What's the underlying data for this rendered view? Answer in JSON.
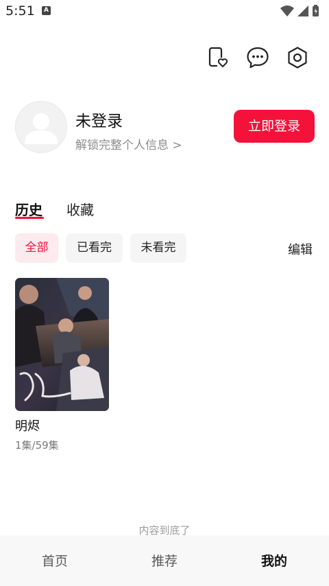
{
  "status_bar": {
    "time": "5:51",
    "notification_badge": "A"
  },
  "top_icons": [
    "favorite-phone-icon",
    "message-icon",
    "settings-icon"
  ],
  "profile": {
    "name": "未登录",
    "subtitle": "解锁完整个人信息 >",
    "login_button": "立即登录"
  },
  "tabs": {
    "history": "历史",
    "favorites": "收藏",
    "active": "history"
  },
  "filters": {
    "all": "全部",
    "watched": "已看完",
    "unwatched": "未看完",
    "edit": "编辑",
    "active": "all"
  },
  "history_items": [
    {
      "title": "明烬",
      "progress": "1集/59集"
    }
  ],
  "end_text": "内容到底了",
  "bottom_nav": {
    "home": "首页",
    "recommend": "推荐",
    "mine": "我的",
    "active": "mine"
  },
  "colors": {
    "accent": "#f4123a",
    "chip_active_bg": "#fdeaee",
    "chip_bg": "#f5f5f5"
  }
}
